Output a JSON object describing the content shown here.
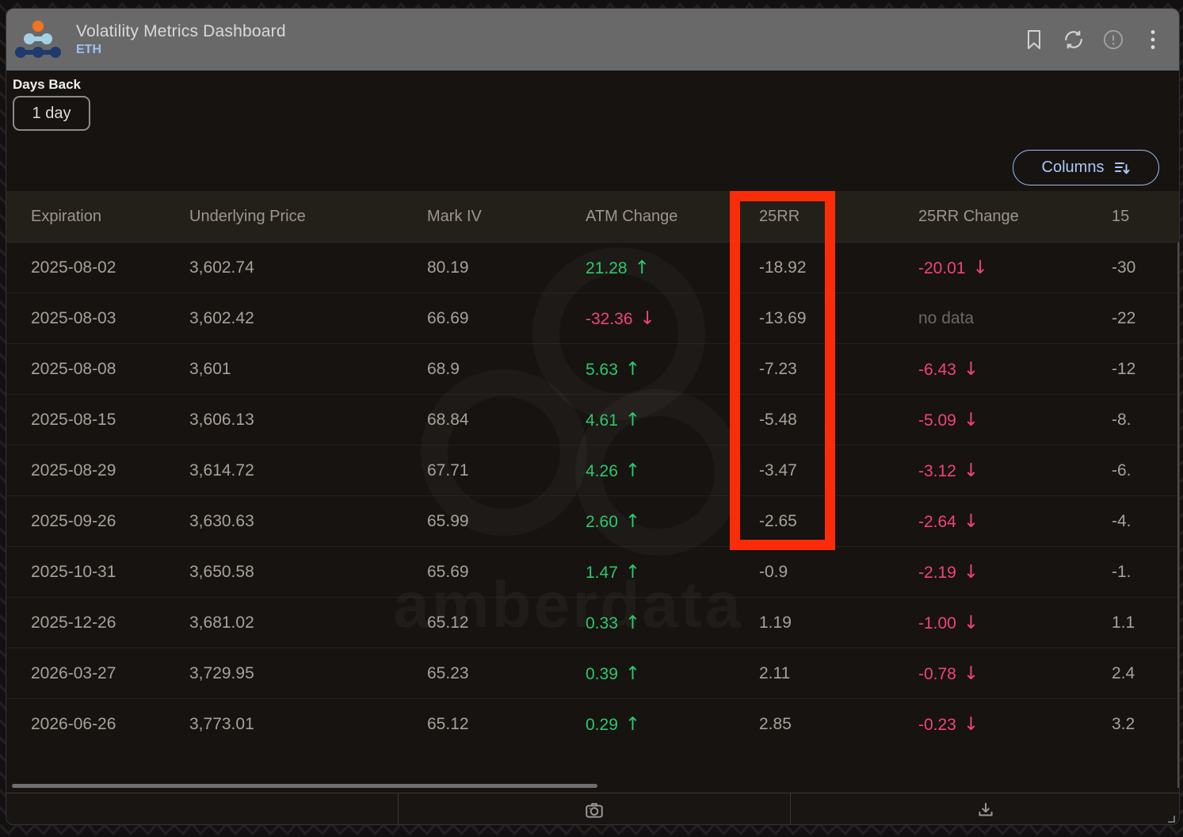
{
  "header": {
    "title": "Volatility Metrics Dashboard",
    "subtitle": "ETH"
  },
  "controls": {
    "days_back_label": "Days Back",
    "days_back_value": "1 day",
    "columns_label": "Columns"
  },
  "table": {
    "columns": {
      "expiration": "Expiration",
      "underlying_price": "Underlying Price",
      "mark_iv": "Mark IV",
      "atm_change": "ATM Change",
      "rr25": "25RR",
      "rr25_change": "25RR Change",
      "last_clipped": "15"
    },
    "rows": [
      {
        "expiration": "2025-08-02",
        "underlying_price": "3,602.74",
        "mark_iv": "80.19",
        "atm_change": "21.28",
        "atm_arrow": "↑",
        "rr25": "-18.92",
        "rr25_change": "-20.01",
        "rr25_arrow": "↓",
        "last": "-30"
      },
      {
        "expiration": "2025-08-03",
        "underlying_price": "3,602.42",
        "mark_iv": "66.69",
        "atm_change": "-32.36",
        "atm_arrow": "↓",
        "rr25": "-13.69",
        "rr25_change": "no data",
        "last": "-22"
      },
      {
        "expiration": "2025-08-08",
        "underlying_price": "3,601",
        "mark_iv": "68.9",
        "atm_change": "5.63",
        "atm_arrow": "↑",
        "rr25": "-7.23",
        "rr25_change": "-6.43",
        "rr25_arrow": "↓",
        "last": "-12"
      },
      {
        "expiration": "2025-08-15",
        "underlying_price": "3,606.13",
        "mark_iv": "68.84",
        "atm_change": "4.61",
        "atm_arrow": "↑",
        "rr25": "-5.48",
        "rr25_change": "-5.09",
        "rr25_arrow": "↓",
        "last": "-8."
      },
      {
        "expiration": "2025-08-29",
        "underlying_price": "3,614.72",
        "mark_iv": "67.71",
        "atm_change": "4.26",
        "atm_arrow": "↑",
        "rr25": "-3.47",
        "rr25_change": "-3.12",
        "rr25_arrow": "↓",
        "last": "-6."
      },
      {
        "expiration": "2025-09-26",
        "underlying_price": "3,630.63",
        "mark_iv": "65.99",
        "atm_change": "2.60",
        "atm_arrow": "↑",
        "rr25": "-2.65",
        "rr25_change": "-2.64",
        "rr25_arrow": "↓",
        "last": "-4."
      },
      {
        "expiration": "2025-10-31",
        "underlying_price": "3,650.58",
        "mark_iv": "65.69",
        "atm_change": "1.47",
        "atm_arrow": "↑",
        "rr25": "-0.9",
        "rr25_change": "-2.19",
        "rr25_arrow": "↓",
        "last": "-1."
      },
      {
        "expiration": "2025-12-26",
        "underlying_price": "3,681.02",
        "mark_iv": "65.12",
        "atm_change": "0.33",
        "atm_arrow": "↑",
        "rr25": "1.19",
        "rr25_change": "-1.00",
        "rr25_arrow": "↓",
        "last": "1.1"
      },
      {
        "expiration": "2026-03-27",
        "underlying_price": "3,729.95",
        "mark_iv": "65.23",
        "atm_change": "0.39",
        "atm_arrow": "↑",
        "rr25": "2.11",
        "rr25_change": "-0.78",
        "rr25_arrow": "↓",
        "last": "2.4"
      },
      {
        "expiration": "2026-06-26",
        "underlying_price": "3,773.01",
        "mark_iv": "65.12",
        "atm_change": "0.29",
        "atm_arrow": "↑",
        "rr25": "2.85",
        "rr25_change": "-0.23",
        "rr25_arrow": "↓",
        "last": "3.2"
      }
    ]
  },
  "watermark": {
    "text": "amberdata"
  },
  "annotation": {
    "highlighted_column": "25RR",
    "box_color": "#fb2d08"
  },
  "colors": {
    "positive_green": "#2bc96d",
    "negative_pink": "#f2437d",
    "accent_blue": "#a9c9f8",
    "annotation_red": "#fb2d08",
    "header_gray": "#696969",
    "logo_orange": "#f5731f",
    "logo_light_blue": "#a5cfe4",
    "logo_navy": "#1e3a6e"
  }
}
